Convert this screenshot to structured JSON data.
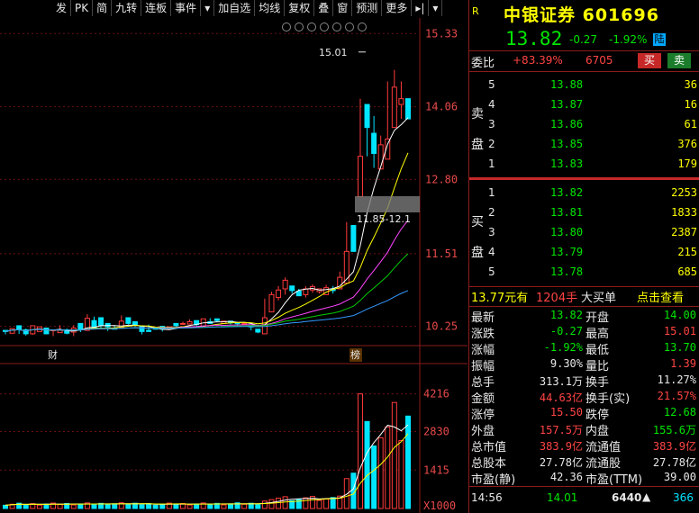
{
  "toolbar": {
    "items": [
      "发",
      "PK",
      "简",
      "九转",
      "连板",
      "事件",
      "▾",
      "加自选",
      "均线",
      "复权",
      "叠",
      "窗",
      "预测",
      "更多",
      "▸|",
      "▾"
    ]
  },
  "chart": {
    "price_axis": [
      "15.33",
      "14.06",
      "12.80",
      "11.51",
      "10.25"
    ],
    "volume_axis": [
      "4216",
      "2830",
      "1415",
      "X1000"
    ],
    "high_label": "15.01",
    "range_label": "11.85-12.1",
    "marker_cai": "财",
    "marker_bang": "榜"
  },
  "chart_data": {
    "type": "candlestick",
    "candles": [
      [
        10.18,
        10.16,
        10.15,
        10.11
      ],
      [
        10.13,
        10.21,
        10.19,
        10.19
      ],
      [
        10.26,
        10.2,
        10.19,
        10.12
      ],
      [
        10.19,
        10.12,
        10.21,
        10.09
      ],
      [
        10.12,
        10.26,
        10.1,
        10.17
      ],
      [
        10.16,
        10.24,
        10.16,
        10.2
      ],
      [
        10.22,
        10.12,
        10.13,
        10.18
      ],
      [
        10.18,
        10.19,
        10.08,
        10.13
      ],
      [
        10.14,
        10.18,
        10.27,
        10.17
      ],
      [
        10.19,
        10.13,
        10.11,
        10.21
      ],
      [
        10.15,
        10.22,
        10.08,
        10.27
      ],
      [
        10.3,
        10.2,
        10.17,
        10.15
      ],
      [
        10.18,
        10.39,
        10.42,
        10.46
      ],
      [
        10.35,
        10.23,
        10.37,
        10.42
      ],
      [
        10.4,
        10.26,
        10.2,
        10.38
      ],
      [
        10.3,
        10.24,
        10.17,
        10.21
      ],
      [
        10.22,
        10.2,
        10.26,
        10.2
      ],
      [
        10.23,
        10.34,
        10.38,
        10.44
      ],
      [
        10.4,
        10.3,
        10.3,
        10.28
      ],
      [
        10.33,
        10.27,
        10.3,
        10.24
      ],
      [
        10.25,
        10.16,
        10.2,
        10.11
      ],
      [
        10.18,
        10.16,
        10.22,
        10.28
      ],
      [
        10.22,
        10.2,
        10.2,
        10.24
      ],
      [
        10.25,
        10.2,
        10.2,
        10.16
      ],
      [
        10.2,
        10.24,
        10.2,
        10.18
      ],
      [
        10.3,
        10.26,
        10.24,
        10.29
      ],
      [
        10.3,
        10.3,
        10.29,
        10.33
      ],
      [
        10.29,
        10.33,
        10.33,
        10.37
      ],
      [
        10.35,
        10.28,
        10.28,
        10.23
      ],
      [
        10.25,
        10.38,
        10.33,
        10.32
      ],
      [
        10.33,
        10.3,
        10.35,
        10.39
      ],
      [
        10.38,
        10.35,
        10.33,
        10.36
      ],
      [
        10.3,
        10.34,
        10.31,
        10.3
      ],
      [
        10.34,
        10.31,
        10.28,
        10.3
      ],
      [
        10.31,
        10.3,
        10.28,
        10.26
      ],
      [
        10.3,
        10.3,
        10.27,
        10.32
      ],
      [
        10.26,
        10.24,
        10.2,
        10.18
      ],
      [
        10.2,
        10.15,
        10.18,
        10.13
      ],
      [
        10.12,
        10.4,
        10.55,
        10.73
      ],
      [
        10.5,
        10.8,
        10.7,
        10.85
      ],
      [
        10.75,
        10.88,
        10.7,
        10.95
      ],
      [
        10.9,
        11.05,
        10.8,
        11.1
      ],
      [
        10.95,
        10.87,
        10.93,
        10.82
      ],
      [
        10.86,
        10.78,
        10.8,
        10.9
      ],
      [
        10.8,
        10.9,
        10.75,
        10.95
      ],
      [
        10.88,
        10.94,
        10.83,
        10.98
      ],
      [
        10.85,
        10.9,
        10.82,
        10.88
      ],
      [
        10.8,
        10.92,
        10.84,
        10.97
      ],
      [
        10.9,
        10.87,
        10.82,
        10.95
      ],
      [
        10.9,
        11.1,
        10.95,
        11.2
      ],
      [
        11.0,
        11.55,
        12.0,
        12.06
      ],
      [
        12.0,
        11.55,
        11.9,
        12.0
      ],
      [
        12.5,
        13.2,
        13.0,
        14.2
      ],
      [
        14.1,
        13.7,
        13.3,
        13.2
      ],
      [
        13.6,
        13.25,
        13.0,
        13.9
      ],
      [
        12.98,
        13.4,
        13.5,
        13.56
      ],
      [
        13.15,
        13.5,
        14.2,
        14.5
      ],
      [
        13.7,
        14.4,
        14.7,
        14.5
      ],
      [
        14.1,
        14.2,
        13.85,
        14.5
      ],
      [
        14.2,
        13.85,
        13.95,
        14.0
      ]
    ],
    "volume_ylim": [
      0,
      4900
    ],
    "price_ylim": [
      9.9,
      15.6
    ]
  },
  "quote": {
    "tag": "R",
    "name_code": "中银证券 601696",
    "price": "13.82",
    "change": "-0.27",
    "change_pct": "-1.92%",
    "exchange": "陆",
    "wei_bi_label": "委比",
    "wei_bi_pct": "+83.39%",
    "wei_cha": "6705",
    "buy_label": "买",
    "sell_label": "卖"
  },
  "orderbook": {
    "sell_label": "卖盘",
    "buy_label": "买盘",
    "sells": [
      {
        "lvl": "5",
        "price": "13.88",
        "vol": "36"
      },
      {
        "lvl": "4",
        "price": "13.87",
        "vol": "16"
      },
      {
        "lvl": "3",
        "price": "13.86",
        "vol": "61"
      },
      {
        "lvl": "2",
        "price": "13.85",
        "vol": "376"
      },
      {
        "lvl": "1",
        "price": "13.83",
        "vol": "179"
      }
    ],
    "buys": [
      {
        "lvl": "1",
        "price": "13.82",
        "vol": "2253"
      },
      {
        "lvl": "2",
        "price": "13.81",
        "vol": "1833"
      },
      {
        "lvl": "3",
        "price": "13.80",
        "vol": "2387"
      },
      {
        "lvl": "4",
        "price": "13.79",
        "vol": "215"
      },
      {
        "lvl": "5",
        "price": "13.78",
        "vol": "685"
      }
    ]
  },
  "big_order": {
    "price": "13.77元有",
    "qty": "1204手",
    "label": "大买单",
    "link": "点击查看"
  },
  "stats": [
    [
      "最新",
      "13.82",
      "开盘",
      "14.00"
    ],
    [
      "涨跌",
      "-0.27",
      "最高",
      "15.01"
    ],
    [
      "涨幅",
      "-1.92%",
      "最低",
      "13.70"
    ],
    [
      "振幅",
      "9.30%",
      "量比",
      "1.39"
    ],
    [
      "总手",
      "313.1万",
      "换手",
      "11.27%"
    ],
    [
      "金额",
      "44.63亿",
      "换手(实)",
      "21.57%"
    ],
    [
      "涨停",
      "15.50",
      "跌停",
      "12.68"
    ],
    [
      "外盘",
      "157.5万",
      "内盘",
      "155.6万"
    ],
    [
      "总市值",
      "383.9亿",
      "流通值",
      "383.9亿"
    ],
    [
      "总股本",
      "27.78亿",
      "流通股",
      "27.78亿"
    ],
    [
      "市盈(静)",
      "42.36",
      "市盈(TTM)",
      "39.00"
    ]
  ],
  "tick": {
    "time": "14:56",
    "price": "14.01",
    "vol": "6440",
    "arrow": "▲",
    "count": "366"
  }
}
